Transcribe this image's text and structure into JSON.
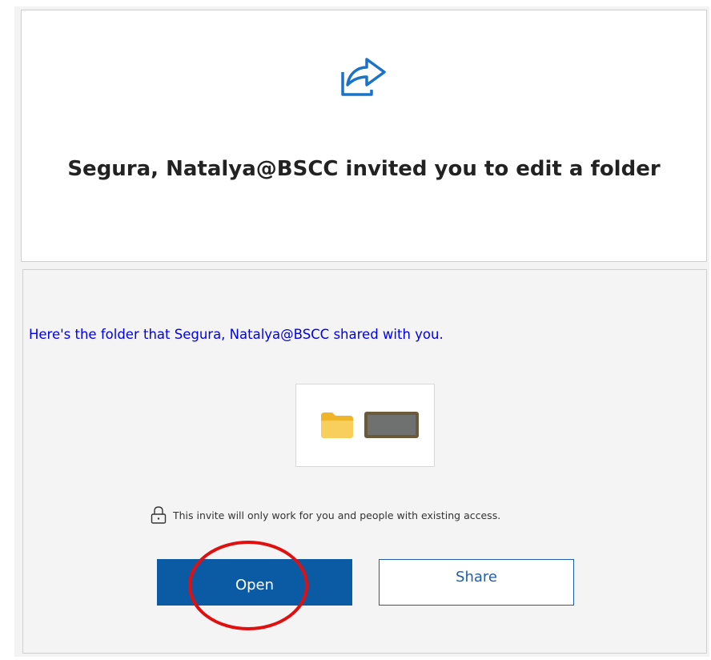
{
  "header": {
    "icon": "share-arrow-icon",
    "title": "Segura, Natalya@BSCC invited you to edit a folder"
  },
  "body": {
    "intro_text": "Here's the folder that Segura, Natalya@BSCC shared with you.",
    "folder": {
      "icon": "folder-icon",
      "name_redacted": true
    },
    "notice": {
      "icon": "lock-icon",
      "text": "This invite will only work for you and people with existing access."
    },
    "buttons": {
      "open_label": "Open",
      "share_label": "Share"
    }
  },
  "colors": {
    "accent": "#0b5aa4",
    "link_text": "#0000ee",
    "annotation": "#e01010",
    "folder_yellow": "#f7c948"
  }
}
